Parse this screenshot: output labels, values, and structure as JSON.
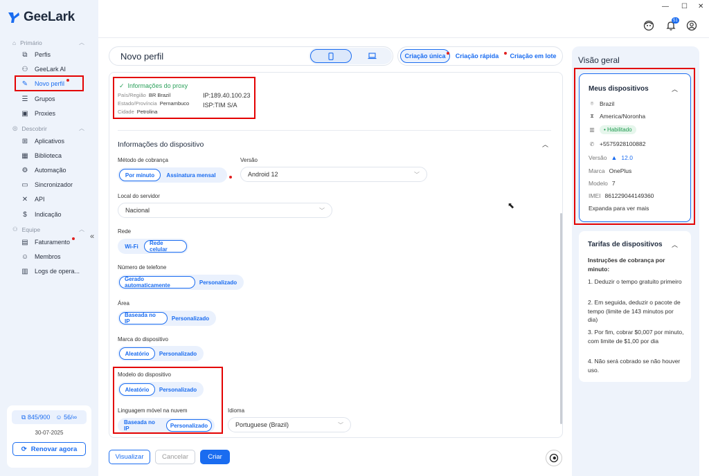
{
  "app": {
    "name": "GeeLark"
  },
  "sidebar": {
    "sections": [
      {
        "label": "Primário",
        "items": [
          {
            "label": "Perfis",
            "icon": "profiles-icon"
          },
          {
            "label": "GeeLark AI",
            "icon": "ai-icon"
          },
          {
            "label": "Novo perfil",
            "icon": "new-profile-icon"
          },
          {
            "label": "Grupos",
            "icon": "groups-icon"
          },
          {
            "label": "Proxies",
            "icon": "proxies-icon"
          }
        ]
      },
      {
        "label": "Descobrir",
        "items": [
          {
            "label": "Aplicativos",
            "icon": "apps-icon"
          },
          {
            "label": "Biblioteca",
            "icon": "library-icon"
          },
          {
            "label": "Automação",
            "icon": "automation-icon"
          },
          {
            "label": "Sincronizador",
            "icon": "sync-icon"
          },
          {
            "label": "API",
            "icon": "api-icon"
          },
          {
            "label": "Indicação",
            "icon": "referral-icon"
          }
        ]
      },
      {
        "label": "Equipe",
        "items": [
          {
            "label": "Faturamento",
            "icon": "billing-icon"
          },
          {
            "label": "Membros",
            "icon": "members-icon"
          },
          {
            "label": "Logs de opera...",
            "icon": "logs-icon"
          }
        ]
      }
    ],
    "usage": {
      "profiles": "845/900",
      "members": "56/∞",
      "date": "30-07-2025"
    },
    "renew_label": "Renovar agora"
  },
  "header": {
    "title": "Novo perfil",
    "modes": [
      "Criação única",
      "Criação rápida",
      "Criação em lote"
    ]
  },
  "proxy": {
    "title": "Informações do proxy",
    "country_label": "País/Região",
    "country_value": "BR Brazil",
    "state_label": "Estado/Província",
    "state_value": "Pernambuco",
    "city_label": "Cidade",
    "city_value": "Petrolina",
    "ip": "IP:189.40.100.23",
    "isp": "ISP:TIM S/A"
  },
  "device": {
    "section_title": "Informações do dispositivo",
    "billing": {
      "label": "Método de cobrança",
      "options": [
        "Por minuto",
        "Assinatura mensal"
      ]
    },
    "version": {
      "label": "Versão",
      "value": "Android 12"
    },
    "server": {
      "label": "Local do servidor",
      "value": "Nacional"
    },
    "network": {
      "label": "Rede",
      "options": [
        "Wi-Fi",
        "Rede celular"
      ]
    },
    "phone": {
      "label": "Número de telefone",
      "options": [
        "Gerado automaticamente",
        "Personalizado"
      ]
    },
    "area": {
      "label": "Área",
      "options": [
        "Baseada no IP",
        "Personalizado"
      ]
    },
    "brand": {
      "label": "Marca do dispositivo",
      "options": [
        "Aleatório",
        "Personalizado"
      ]
    },
    "model": {
      "label": "Modelo do dispositivo",
      "options": [
        "Aleatório",
        "Personalizado"
      ]
    },
    "language": {
      "label": "Linguagem móvel na nuvem",
      "options": [
        "Baseada no IP",
        "Personalizado"
      ]
    },
    "idioma": {
      "label": "Idioma",
      "value": "Portuguese (Brazil)"
    }
  },
  "footer": {
    "preview": "Visualizar",
    "cancel": "Cancelar",
    "create": "Criar"
  },
  "overview": {
    "title": "Visão geral",
    "devices": {
      "title": "Meus dispositivos",
      "country": "Brazil",
      "timezone": "America/Noronha",
      "status": "• Habilitado",
      "phone": "+5575928100882",
      "version_label": "Versão",
      "version_value": "12.0",
      "brand_label": "Marca",
      "brand_value": "OnePlus",
      "model_label": "Modelo",
      "model_value": "7",
      "imei_label": "IMEI",
      "imei_value": "861229044149360",
      "expand": "Expanda para ver mais"
    },
    "tariffs": {
      "title": "Tarifas de dispositivos",
      "heading": "Instruções de cobrança por minuto:",
      "items": [
        "1. Deduzir o tempo gratuito primeiro",
        "2. Em seguida, deduzir o pacote de tempo (limite de 143 minutos por dia)",
        "3. Por fim, cobrar $0,007 por minuto, com limite de $1,00 por dia",
        "4. Não será cobrado se não houver uso."
      ]
    }
  },
  "notifications": {
    "count": "51"
  },
  "colors": {
    "accent": "#1a6cf0",
    "highlight": "#e30000",
    "success": "#1d9a4e"
  }
}
